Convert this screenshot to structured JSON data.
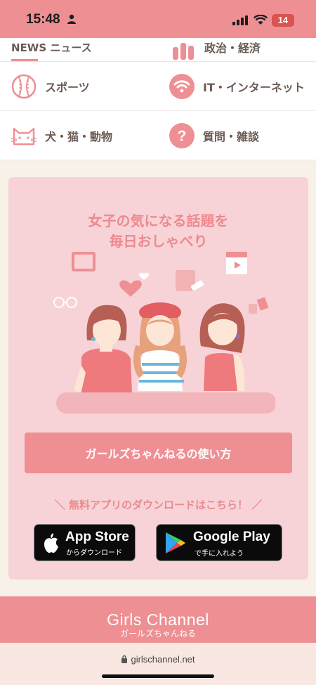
{
  "status_bar": {
    "time": "15:48",
    "battery": "14"
  },
  "categories": {
    "partial_left": "NEWS ニュース",
    "partial_right": "政治・経済",
    "items": [
      {
        "label": "スポーツ",
        "icon": "baseball-icon"
      },
      {
        "label": "IT・インターネット",
        "icon": "wifi-icon"
      },
      {
        "label": "犬・猫・動物",
        "icon": "cat-icon"
      },
      {
        "label": "質問・雑談",
        "icon": "question-icon"
      }
    ]
  },
  "promo": {
    "title_line1": "女子の気になる話題を",
    "title_line2": "毎日おしゃべり",
    "howto_button": "ガールズちゃんねるの使い方",
    "free_app": "＼ 無料アプリのダウンロードはこちら！ ／",
    "app_store_big": "App Store",
    "app_store_small": "からダウンロード",
    "google_play_big": "Google Play",
    "google_play_small": "で手に入れよう"
  },
  "footer": {
    "logo": "Girls Channel",
    "sub": "ガールズちゃんねる"
  },
  "browser": {
    "url": "girlschannel.net"
  },
  "colors": {
    "accent": "#ee8f93",
    "card": "#f7d3d8",
    "background": "#f7f1e8"
  }
}
